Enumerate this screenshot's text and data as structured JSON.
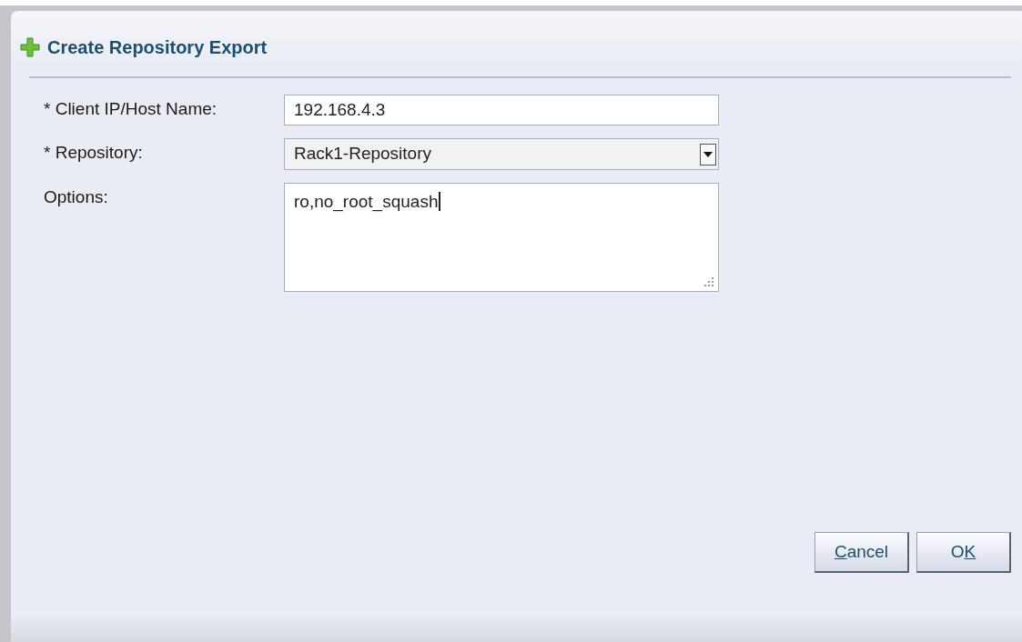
{
  "dialog": {
    "title": "Create Repository Export"
  },
  "fields": [
    {
      "kind": "text",
      "label": "* Client IP/Host Name:",
      "value": "192.168.4.3"
    },
    {
      "kind": "select",
      "label": "* Repository:",
      "value": "Rack1-Repository"
    },
    {
      "kind": "textarea",
      "label": "Options:",
      "value": "ro,no_root_squash"
    }
  ],
  "buttons": [
    {
      "mnemonic": "C",
      "after": "ancel"
    },
    {
      "before": "O",
      "mnemonic": "K"
    }
  ]
}
